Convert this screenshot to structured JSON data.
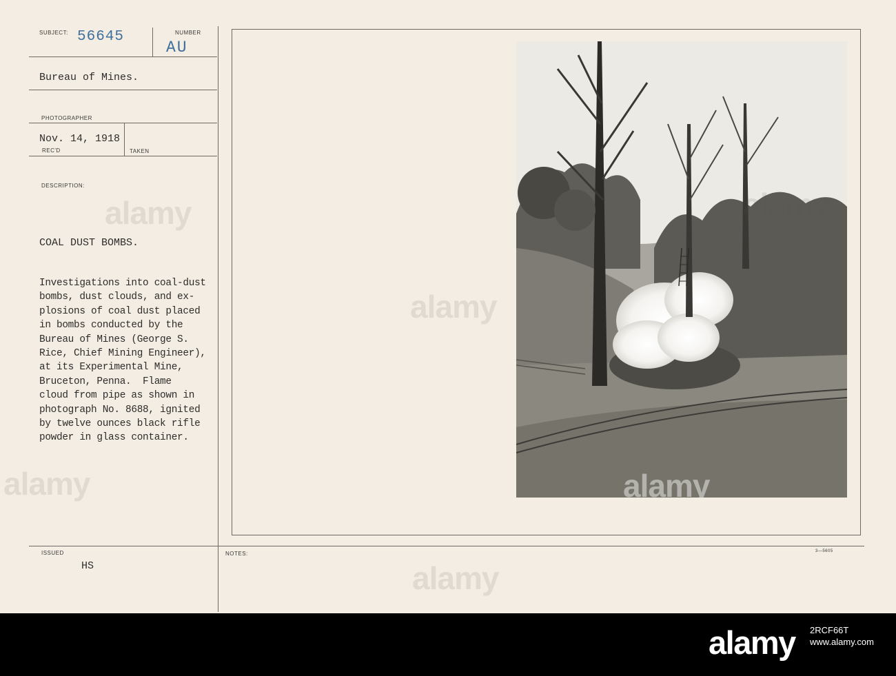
{
  "card": {
    "subject_label": "SUBJECT:",
    "subject_number": "56645",
    "number_label": "NUMBER",
    "number_value": "AU",
    "agency": "Bureau of Mines.",
    "photographer_label": "PHOTOGRAPHER",
    "date": "Nov. 14, 1918",
    "recd_label": "REC'D",
    "taken_label": "TAKEN",
    "description_label": "DESCRIPTION:",
    "title": "COAL DUST BOMBS.",
    "description_lines": [
      "Investigations into coal-dust",
      "bombs, dust clouds, and ex-",
      "plosions of coal dust placed",
      "in bombs conducted by the",
      "Bureau of Mines (George S.",
      "Rice, Chief Mining Engineer),",
      "at its Experimental Mine,",
      "Bruceton, Penna.  Flame",
      "cloud from pipe as shown in",
      "photograph No. 8688, ignited",
      "by twelve ounces black rifle",
      "powder in glass container."
    ],
    "issued_label": "ISSUED",
    "issued_value": "HS",
    "notes_label": "NOTES:",
    "form_number": "3—5605"
  },
  "watermark": "alamy",
  "footer": {
    "brand": "alamy",
    "image_id": "2RCF66T",
    "site": "www.alamy.com"
  },
  "colors": {
    "card_background": "#f3ede4",
    "stamp_ink": "#3f6f9a",
    "footer_background": "#000000"
  }
}
